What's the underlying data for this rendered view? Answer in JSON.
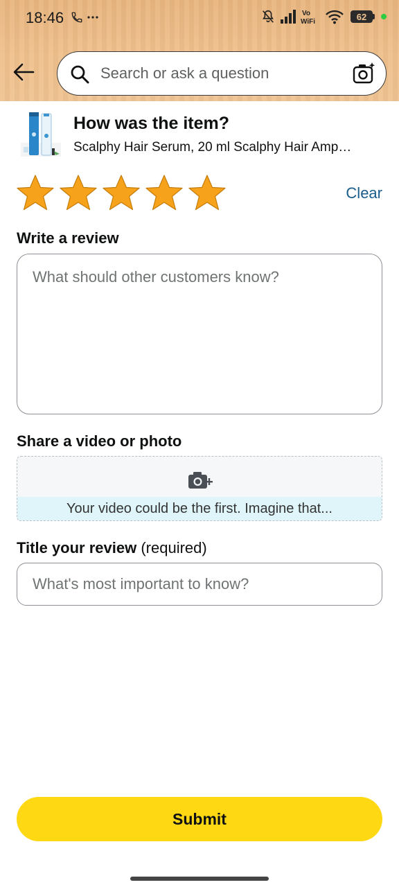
{
  "status_bar": {
    "time": "18:46",
    "battery": "62"
  },
  "search": {
    "placeholder": "Search or ask a question"
  },
  "product": {
    "question": "How was the item?",
    "name": "Scalphy Hair Serum, 20 ml Scalphy Hair Amp…"
  },
  "rating": {
    "value": 5,
    "max": 5,
    "clear_label": "Clear",
    "star_color": "#f7a21b"
  },
  "review": {
    "label": "Write a review",
    "placeholder": "What should other customers know?"
  },
  "media": {
    "label": "Share a video or photo",
    "caption": "Your video could be the first. Imagine that..."
  },
  "title_field": {
    "label": "Title your review",
    "required_label": "(required)",
    "placeholder": "What's most important to know?"
  },
  "submit": {
    "label": "Submit",
    "color": "#ffd814"
  },
  "icons": [
    "phone-icon",
    "more-icon",
    "mute-icon",
    "signal-icon",
    "vowifi-icon",
    "wifi-icon",
    "battery-icon",
    "back-arrow-icon",
    "search-icon",
    "camera-search-icon",
    "star-icon",
    "camera-add-icon"
  ]
}
